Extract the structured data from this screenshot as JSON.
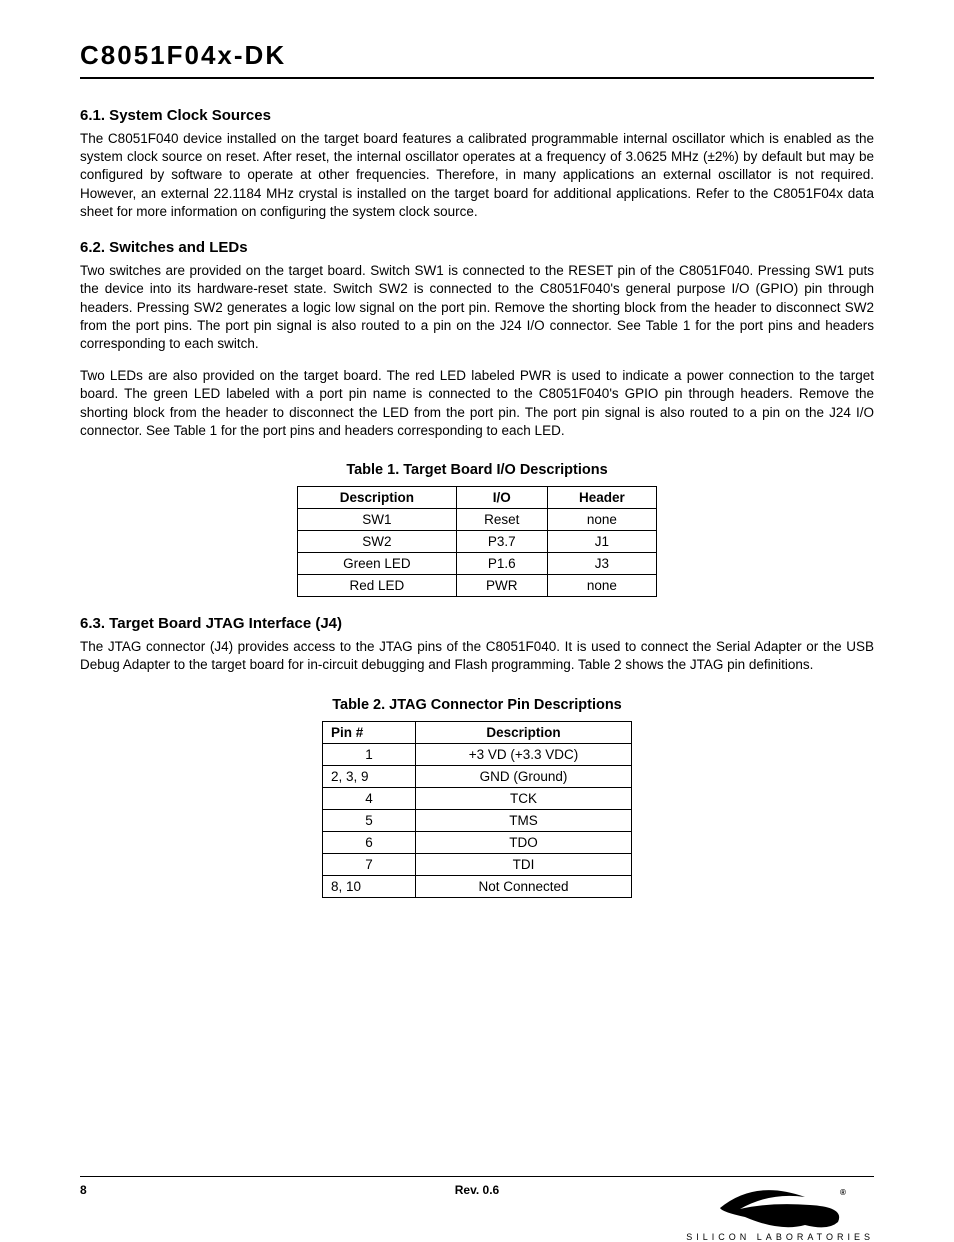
{
  "header": {
    "doc_title": "C8051F04x-DK"
  },
  "sections": [
    {
      "heading": "6.1.  System Clock Sources",
      "paragraphs": [
        "The C8051F040 device installed on the target board features a calibrated programmable internal oscillator which is enabled as the system clock source on reset. After reset, the internal oscillator operates at a frequency of 3.0625 MHz (±2%) by default but may be configured by software to operate at other frequencies. Therefore, in many applications an external oscillator is not required. However, an external 22.1184 MHz crystal is installed on the target board for additional applications. Refer to the C8051F04x data sheet for more information on configuring the system clock source."
      ]
    },
    {
      "heading": "6.2.  Switches and LEDs",
      "paragraphs": [
        "Two switches are provided on the target board. Switch SW1 is connected to the RESET pin of the C8051F040. Pressing SW1 puts the device into its hardware-reset state. Switch SW2 is connected to the C8051F040's general purpose I/O (GPIO) pin through headers. Pressing SW2 generates a logic low signal on the port pin. Remove the shorting block from the header to disconnect SW2 from the port pins. The port pin signal is also routed to a pin on the J24 I/O connector. See Table 1 for the port pins and headers corresponding to each switch.",
        "Two LEDs are also provided on the target board. The red LED labeled PWR is used to indicate a power connection to the target board. The green LED labeled with a port pin name is connected to the C8051F040's GPIO pin through headers. Remove the shorting block from the header to disconnect the LED from the port pin. The port pin signal is also routed to a pin on the J24 I/O connector. See Table 1 for the port pins and headers corresponding to each LED."
      ]
    },
    {
      "heading": "6.3.  Target Board JTAG Interface (J4)",
      "paragraphs": [
        "The JTAG connector (J4) provides access to the JTAG pins of the C8051F040. It is used to connect the Serial Adapter or the USB Debug Adapter to the target board for in-circuit debugging and Flash programming. Table 2 shows the JTAG pin definitions."
      ]
    }
  ],
  "table1": {
    "caption": "Table 1.  Target Board I/O Descriptions",
    "headers": [
      "Description",
      "I/O",
      "Header"
    ],
    "rows": [
      [
        "SW1",
        "Reset",
        "none"
      ],
      [
        "SW2",
        "P3.7",
        "J1"
      ],
      [
        "Green LED",
        "P1.6",
        "J3"
      ],
      [
        "Red LED",
        "PWR",
        "none"
      ]
    ]
  },
  "table2": {
    "caption": "Table 2.  JTAG Connector Pin Descriptions",
    "headers": [
      "Pin #",
      "Description"
    ],
    "rows": [
      [
        "1",
        "+3 VD (+3.3 VDC)"
      ],
      [
        "2, 3, 9",
        "GND (Ground)"
      ],
      [
        "4",
        "TCK"
      ],
      [
        "5",
        "TMS"
      ],
      [
        "6",
        "TDO"
      ],
      [
        "7",
        "TDI"
      ],
      [
        "8, 10",
        "Not Connected"
      ]
    ]
  },
  "footer": {
    "page": "8",
    "rev": "Rev. 0.6",
    "company": "SILICON LABORATORIES"
  }
}
